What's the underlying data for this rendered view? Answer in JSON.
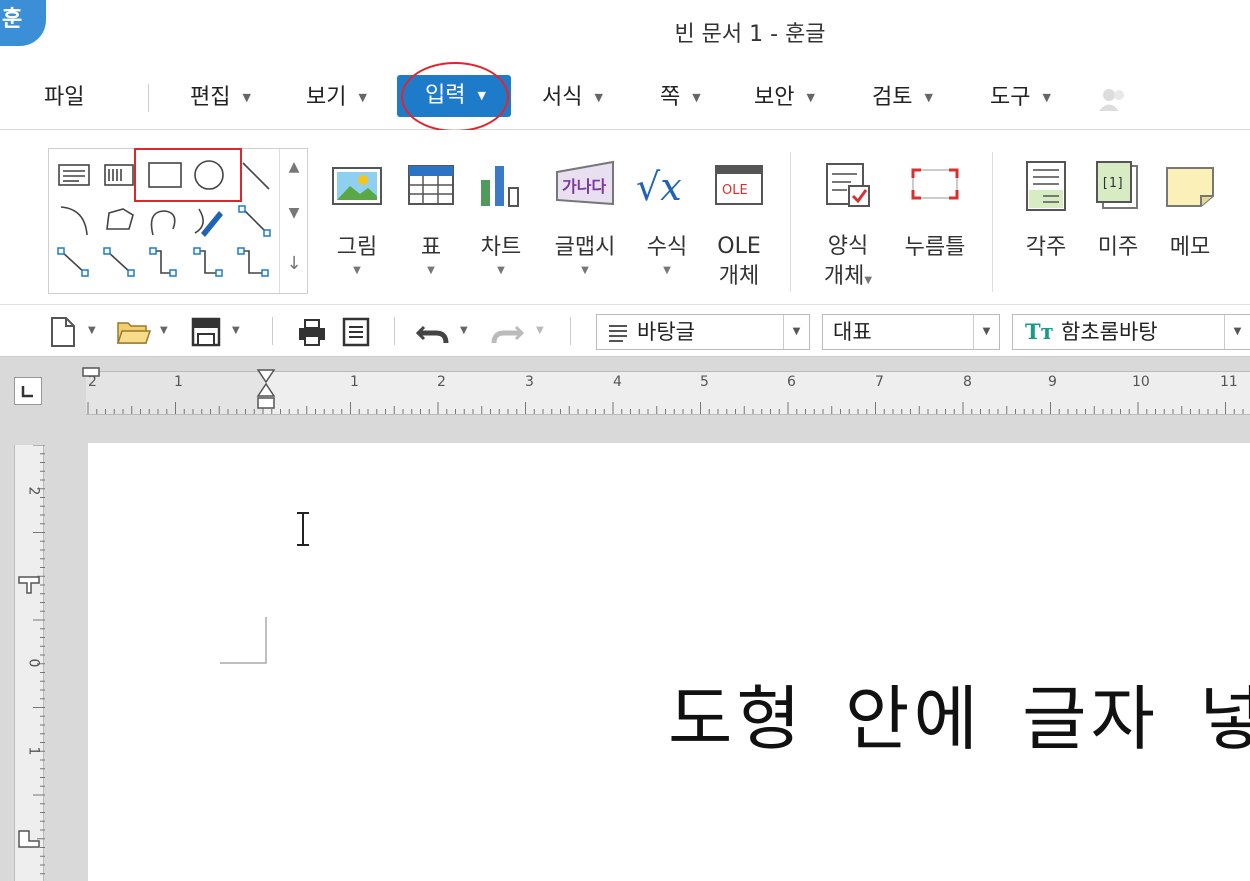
{
  "window": {
    "app_logo": "훈",
    "title": "빈 문서 1 - 훈글"
  },
  "menu": {
    "items": [
      {
        "label": "파일"
      },
      {
        "label": "편집"
      },
      {
        "label": "보기"
      },
      {
        "label": "입력"
      },
      {
        "label": "서식"
      },
      {
        "label": "쪽"
      },
      {
        "label": "보안"
      },
      {
        "label": "검토"
      },
      {
        "label": "도구"
      }
    ],
    "active": "입력",
    "accent_color": "#1e7bc9"
  },
  "ribbon": {
    "buttons": [
      {
        "label": "그림",
        "icon": "picture-icon"
      },
      {
        "label": "표",
        "icon": "table-icon"
      },
      {
        "label": "차트",
        "icon": "chart-icon"
      },
      {
        "label": "글맵시",
        "icon": "wordart-icon",
        "icon_text": "가나다"
      },
      {
        "label": "수식",
        "icon": "formula-icon",
        "icon_text": "√x"
      },
      {
        "label": "OLE",
        "label2": "개체",
        "icon": "ole-icon",
        "icon_text": "OLE"
      },
      {
        "label": "양식",
        "label2": "개체",
        "icon": "form-icon"
      },
      {
        "label": "누름틀",
        "icon": "field-icon"
      },
      {
        "label": "각주",
        "icon": "footnote-icon"
      },
      {
        "label": "미주",
        "icon": "endnote-icon",
        "icon_text": "[1]"
      },
      {
        "label": "메모",
        "icon": "memo-icon"
      }
    ],
    "highlight_color": "#e0252f"
  },
  "toolbar": {
    "style_combo": "바탕글",
    "lang_combo": "대표",
    "font_combo": "함초롬바탕"
  },
  "ruler": {
    "h_labels": [
      "2",
      "1",
      "1",
      "2",
      "3",
      "4",
      "5",
      "6",
      "7",
      "8",
      "9",
      "10",
      "11"
    ],
    "v_labels": [
      "2",
      "0",
      "1"
    ]
  },
  "document": {
    "text": "도형 안에 글자 넣"
  }
}
